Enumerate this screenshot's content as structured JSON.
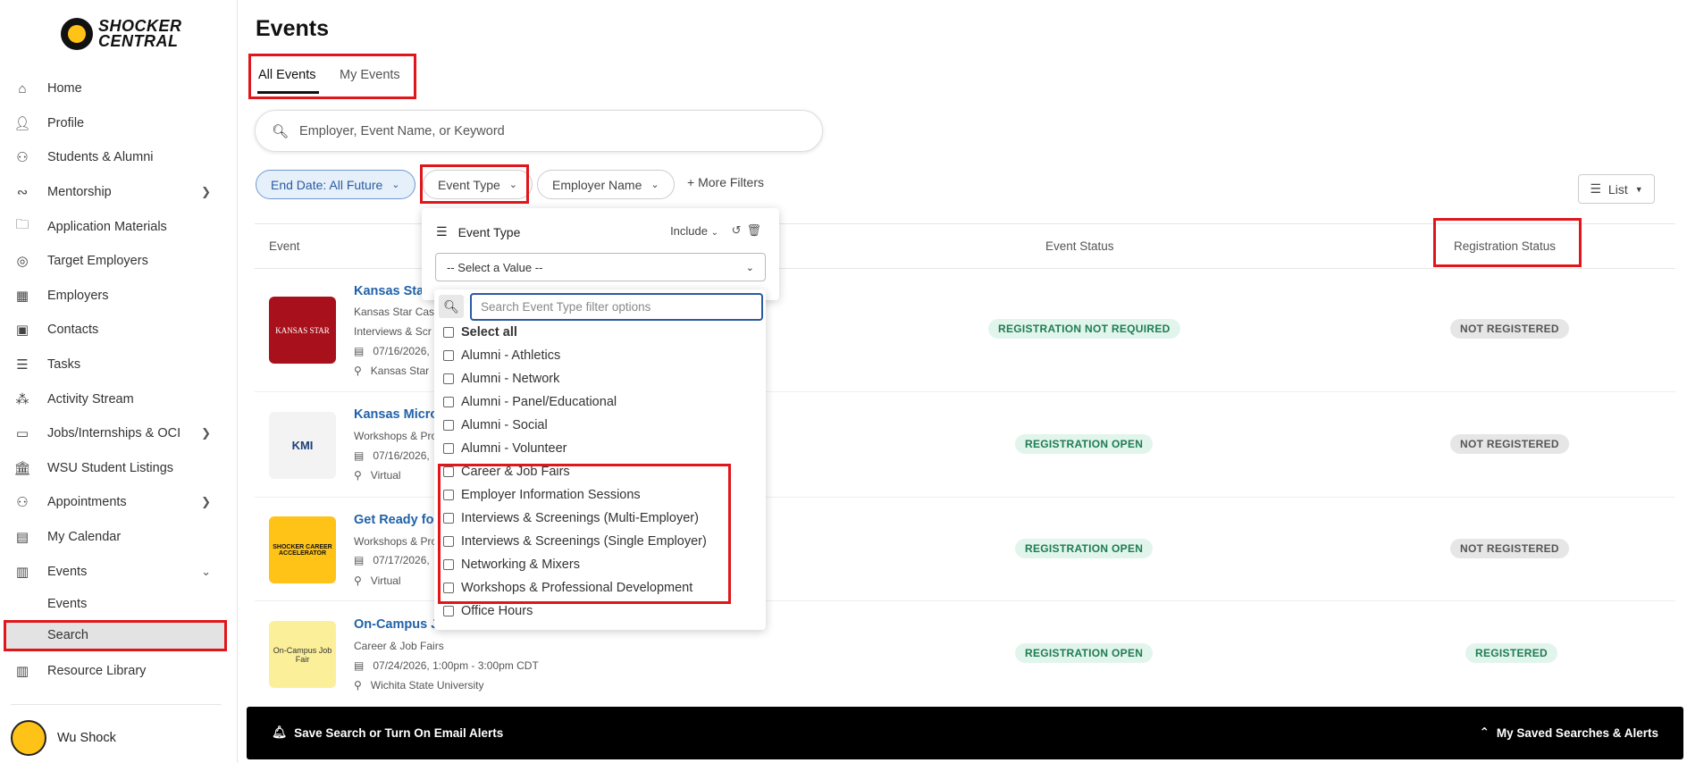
{
  "brand": {
    "line1": "SHOCKER",
    "line2": "CENTRAL"
  },
  "sidebar": {
    "items": [
      {
        "label": "Home"
      },
      {
        "label": "Profile"
      },
      {
        "label": "Students & Alumni"
      },
      {
        "label": "Mentorship"
      },
      {
        "label": "Application Materials"
      },
      {
        "label": "Target Employers"
      },
      {
        "label": "Employers"
      },
      {
        "label": "Contacts"
      },
      {
        "label": "Tasks"
      },
      {
        "label": "Activity Stream"
      },
      {
        "label": "Jobs/Internships & OCI"
      },
      {
        "label": "WSU Student Listings"
      },
      {
        "label": "Appointments"
      },
      {
        "label": "My Calendar"
      },
      {
        "label": "Events"
      }
    ],
    "events_sub": [
      {
        "label": "Events"
      },
      {
        "label": "Search"
      }
    ],
    "after": {
      "label": "Resource Library"
    },
    "user": "Wu Shock"
  },
  "page": {
    "title": "Events"
  },
  "tabs": [
    {
      "label": "All Events"
    },
    {
      "label": "My Events"
    }
  ],
  "search": {
    "placeholder": "Employer, Event Name, or Keyword"
  },
  "filters": {
    "end_date": "End Date: All Future",
    "event_type": "Event Type",
    "employer_name": "Employer Name",
    "more": "More Filters",
    "view": "List"
  },
  "table": {
    "headers": {
      "event": "Event",
      "status": "Event Status",
      "registration": "Registration Status"
    },
    "rows": [
      {
        "title": "Kansas Star",
        "line1": "Kansas Star Casi",
        "line2": "Interviews & Scr",
        "date": "07/16/2026,",
        "location": "Kansas Star",
        "status": "REGISTRATION NOT REQUIRED",
        "registration": "NOT REGISTERED",
        "thumb_text": "KANSAS STAR"
      },
      {
        "title": "Kansas Micro",
        "line1": "Workshops & Pro",
        "line2": "",
        "date": "07/16/2026,",
        "location": "Virtual",
        "status": "REGISTRATION OPEN",
        "registration": "NOT REGISTERED",
        "thumb_text": "KMI"
      },
      {
        "title": "Get Ready for",
        "line1": "Workshops & Pro",
        "line2": "",
        "date": "07/17/2026,",
        "location": "Virtual",
        "status": "REGISTRATION OPEN",
        "registration": "NOT REGISTERED",
        "thumb_text": "SHOCKER CAREER ACCELERATOR"
      },
      {
        "title": "On-Campus J",
        "line1": "Career & Job Fairs",
        "line2": "",
        "date": "07/24/2026, 1:00pm - 3:00pm CDT",
        "location": "Wichita State University",
        "status": "REGISTRATION OPEN",
        "registration": "REGISTERED",
        "thumb_text": "On-Campus Job Fair"
      }
    ]
  },
  "dropdown": {
    "title": "Event Type",
    "include": "Include",
    "select_placeholder": "-- Select a Value --",
    "search_placeholder": "Search Event Type filter options",
    "options": [
      "Select all",
      "Alumni - Athletics",
      "Alumni - Network",
      "Alumni - Panel/Educational",
      "Alumni - Social",
      "Alumni - Volunteer",
      "Career & Job Fairs",
      "Employer Information Sessions",
      "Interviews & Screenings (Multi-Employer)",
      "Interviews & Screenings (Single Employer)",
      "Networking & Mixers",
      "Workshops & Professional Development",
      "Office Hours"
    ]
  },
  "alerts": {
    "left": "Save Search or Turn On Email Alerts",
    "right": "My Saved Searches & Alerts"
  }
}
